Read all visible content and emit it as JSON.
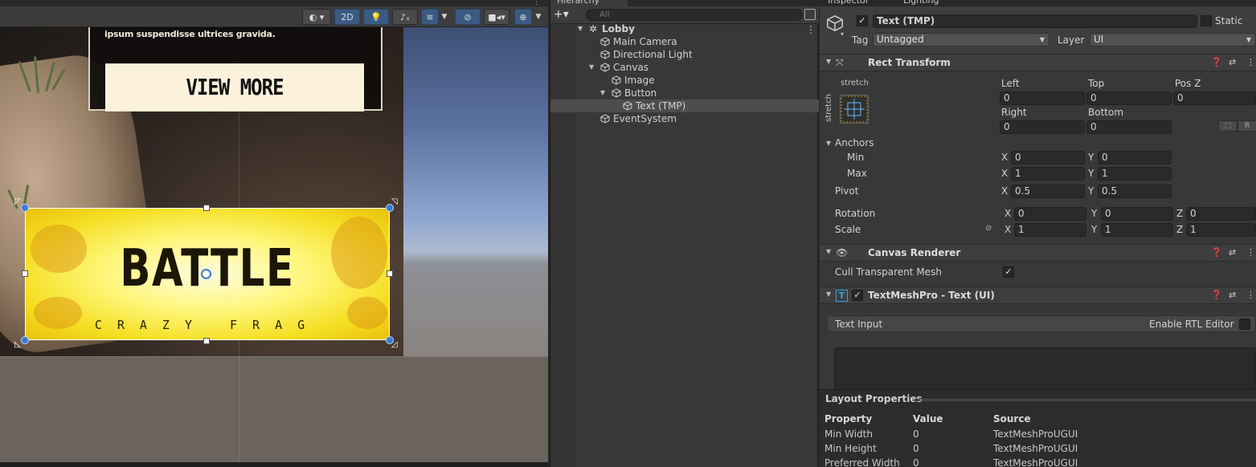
{
  "scene": {
    "toolbar": {
      "mode_2d": "2D"
    },
    "card_text": "ipsum suspendisse ultrices gravida.",
    "view_more_label": "VIEW MORE",
    "battle_title": "BATTLE",
    "battle_subtitle": "CRAZY FRAG"
  },
  "hierarchy": {
    "tab_label": "Hierarchy",
    "add_label": "+▾",
    "search_placeholder": "All",
    "items": [
      {
        "label": "Lobby"
      },
      {
        "label": "Main Camera"
      },
      {
        "label": "Directional Light"
      },
      {
        "label": "Canvas"
      },
      {
        "label": "Image"
      },
      {
        "label": "Button"
      },
      {
        "label": "Text (TMP)"
      },
      {
        "label": "EventSystem"
      }
    ]
  },
  "inspector": {
    "tabs": [
      "Inspector",
      "Lighting"
    ],
    "object_name": "Text (TMP)",
    "static_label": "Static",
    "tag_label": "Tag",
    "tag_value": "Untagged",
    "layer_label": "Layer",
    "layer_value": "UI",
    "rect_transform": {
      "title": "Rect Transform",
      "preset_top": "stretch",
      "preset_side": "stretch",
      "left_label": "Left",
      "left": "0",
      "top_label": "Top",
      "top": "0",
      "posz_label": "Pos Z",
      "posz": "0",
      "right_label": "Right",
      "right": "0",
      "bottom_label": "Bottom",
      "bottom": "0",
      "raw_btn": "R",
      "anchors_label": "Anchors",
      "min_label": "Min",
      "min_x": "0",
      "min_y": "0",
      "max_label": "Max",
      "max_x": "1",
      "max_y": "1",
      "pivot_label": "Pivot",
      "pivot_x": "0.5",
      "pivot_y": "0.5",
      "rotation_label": "Rotation",
      "rot_x": "0",
      "rot_y": "0",
      "rot_z": "0",
      "scale_label": "Scale",
      "scale_x": "1",
      "scale_y": "1",
      "scale_z": "1",
      "x": "X",
      "y": "Y",
      "z": "Z"
    },
    "canvas_renderer": {
      "title": "Canvas Renderer",
      "cull_label": "Cull Transparent Mesh"
    },
    "tmp": {
      "title": "TextMeshPro - Text (UI)",
      "text_input_label": "Text Input",
      "rtl_label": "Enable RTL Editor"
    },
    "layout": {
      "title": "Layout Properties",
      "headers": [
        "Property",
        "Value",
        "Source"
      ],
      "rows": [
        [
          "Min Width",
          "0",
          "TextMeshProUGUI"
        ],
        [
          "Min Height",
          "0",
          "TextMeshProUGUI"
        ],
        [
          "Preferred Width",
          "0",
          "TextMeshProUGUI"
        ]
      ]
    }
  },
  "colors": {
    "accent": "#3a7bd5",
    "battle_yellow": "#fff67a",
    "panel_bg": "#383838"
  }
}
